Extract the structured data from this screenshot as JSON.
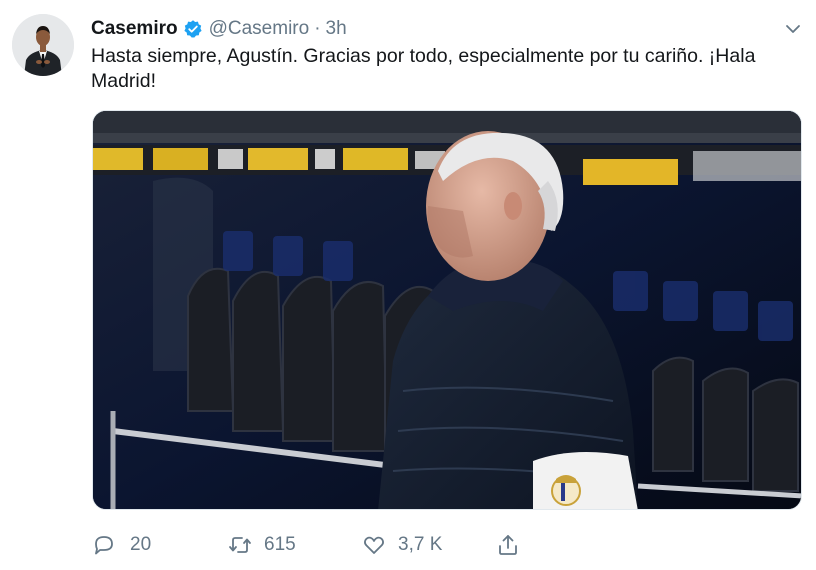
{
  "tweet": {
    "author_name": "Casemiro",
    "handle": "@Casemiro",
    "separator": "·",
    "time": "3h",
    "text": "Hasta siempre, Agustín. Gracias por todo, especialmente por tu cariño. ¡Hala Madrid!",
    "verified_color": "#1da1f2"
  },
  "actions": {
    "reply_count": "20",
    "retweet_count": "615",
    "like_count": "3,7 K"
  },
  "icons": {
    "verified": "verified-badge-icon",
    "caret": "chevron-down-icon",
    "reply": "reply-icon",
    "retweet": "retweet-icon",
    "like": "heart-icon",
    "share": "share-icon"
  },
  "colors": {
    "text": "#14171a",
    "secondary": "#657786",
    "border": "#e1e8ed"
  }
}
